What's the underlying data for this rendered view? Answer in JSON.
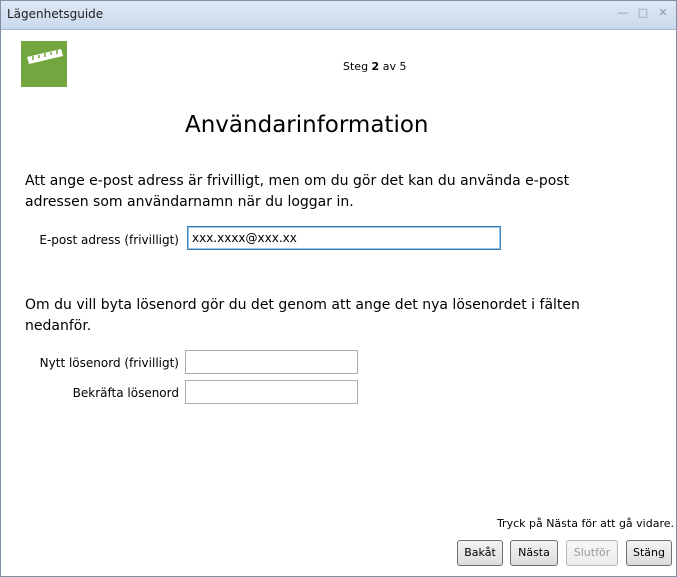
{
  "window": {
    "title": "Lägenhetsguide",
    "controls": [
      "minimize-icon",
      "maximize-icon",
      "close-icon"
    ]
  },
  "header": {
    "step_prefix": "Steg ",
    "step_current": "2",
    "step_suffix": " av 5"
  },
  "page": {
    "heading": "Användarinformation",
    "intro_email": "Att ange e-post adress är frivilligt, men om du gör det kan du använda e-post adressen som användarnamn när du loggar in.",
    "intro_password": "Om du vill byta lösenord gör du det genom att ange det nya lösenordet i fälten nedanför."
  },
  "form": {
    "email_label": "E-post adress (frivilligt)",
    "email_value": "xxx.xxxx@xxx.xx",
    "new_password_label": "Nytt lösenord (frivilligt)",
    "new_password_value": "",
    "confirm_password_label": "Bekräfta lösenord",
    "confirm_password_value": ""
  },
  "footer": {
    "hint": "Tryck på Nästa för att gå vidare.",
    "back_label": "Bakåt",
    "next_label": "Nästa",
    "finish_label": "Slutför",
    "close_label": "Stäng"
  },
  "colors": {
    "logo_green": "#74a63f",
    "focus_border": "#3c7fb1"
  }
}
